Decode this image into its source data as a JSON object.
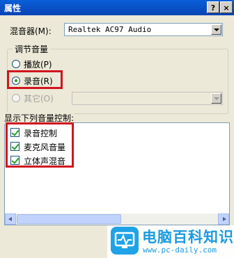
{
  "window": {
    "title": "属性",
    "help_label": "?",
    "close_label": "×"
  },
  "mixer": {
    "label": "混音器(M):",
    "value": "Realtek AC97 Audio"
  },
  "group": {
    "title": "调节音量",
    "options": [
      {
        "label": "播放(P)",
        "selected": false,
        "enabled": true
      },
      {
        "label": "录音(R)",
        "selected": true,
        "enabled": true
      },
      {
        "label": "其它(O)",
        "selected": false,
        "enabled": false
      }
    ],
    "other_value": ""
  },
  "list": {
    "heading": "显示下列音量控制:",
    "items": [
      {
        "label": "录音控制",
        "checked": true
      },
      {
        "label": "麦克风音量",
        "checked": true
      },
      {
        "label": "立体声混音",
        "checked": true
      }
    ]
  },
  "watermark": {
    "title": "电脑百科知识",
    "url": "www.pc-daily.com"
  },
  "colors": {
    "highlight": "#d0151e",
    "titlebar": "#0a5fd8",
    "watermark": "#1b9be0"
  }
}
